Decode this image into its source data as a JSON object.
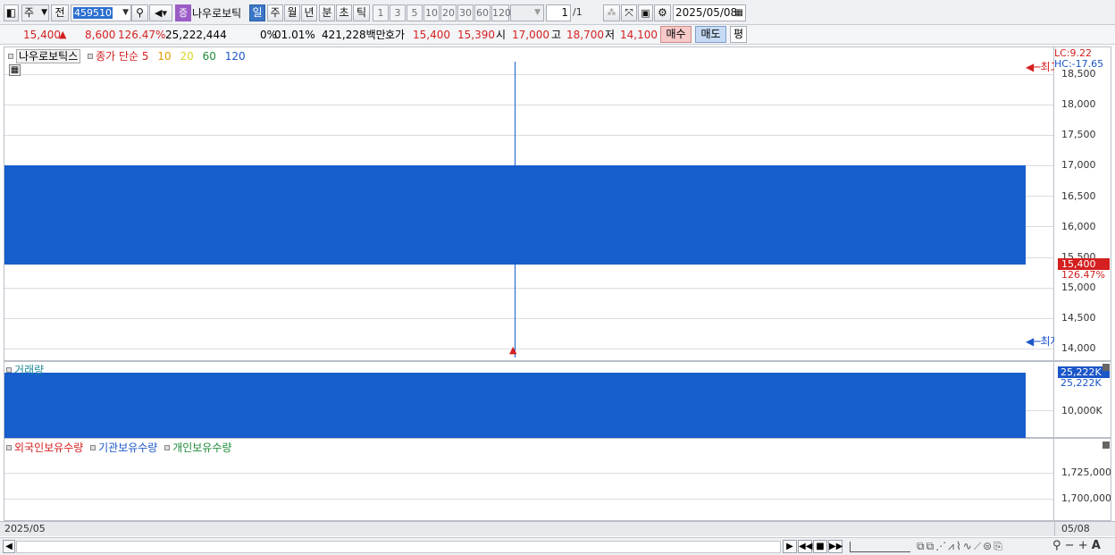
{
  "toolbar": {
    "period_main": "주",
    "prev_label": "전",
    "stock_code": "459510",
    "stock_badge": "증",
    "stock_name": "나우로보틱",
    "periods": [
      "일",
      "주",
      "월",
      "년",
      "분",
      "초",
      "틱"
    ],
    "active_period": "일",
    "intervals": [
      "1",
      "3",
      "5",
      "10",
      "20",
      "30",
      "60",
      "120"
    ],
    "page_input": "1",
    "page_total": "/1",
    "date": "2025/05/08"
  },
  "quote": {
    "price": "15,400",
    "arrow": "▲",
    "change": "8,600",
    "change_pct": "126.47%",
    "volume": "25,222,444",
    "rate_label": "0%",
    "rate_value": "01.01%",
    "amount": "421,228백만",
    "ask_label": "호가",
    "ask1": "15,400",
    "ask2": "15,390",
    "open_label": "시",
    "open": "17,000",
    "high_label": "고",
    "high": "18,700",
    "low_label": "저",
    "low": "14,100",
    "buy": "매수",
    "sell": "매도",
    "eval": "평"
  },
  "price_panel": {
    "stock_tag": "나우로보틱스",
    "ma_label": "종가 단순",
    "ma_periods": [
      "5",
      "10",
      "20",
      "60",
      "120"
    ],
    "lc": "LC:9.22",
    "hc": "HC:-17.65",
    "high_marker": "최고",
    "low_marker": "최저",
    "current_price": "15,400",
    "current_pct": "126.47%",
    "ticks": [
      "18,500",
      "18,000",
      "17,500",
      "17,000",
      "16,500",
      "16,000",
      "15,500",
      "15,000",
      "14,500",
      "14,000"
    ]
  },
  "volume_panel": {
    "label": "거래량",
    "current": "25,222K",
    "current2": "25,222K",
    "ticks": [
      "10,000K"
    ]
  },
  "holdings_panel": {
    "legend": [
      "외국인보유수량",
      "기관보유수량",
      "개인보유수량"
    ],
    "ticks": [
      "1,725,000",
      "1,700,000"
    ]
  },
  "footer": {
    "left_date": "2025/05",
    "right_date": "05/08"
  },
  "colors": {
    "candle": "#155ecb",
    "rise": "#d42020",
    "fall": "#1b56c8"
  }
}
